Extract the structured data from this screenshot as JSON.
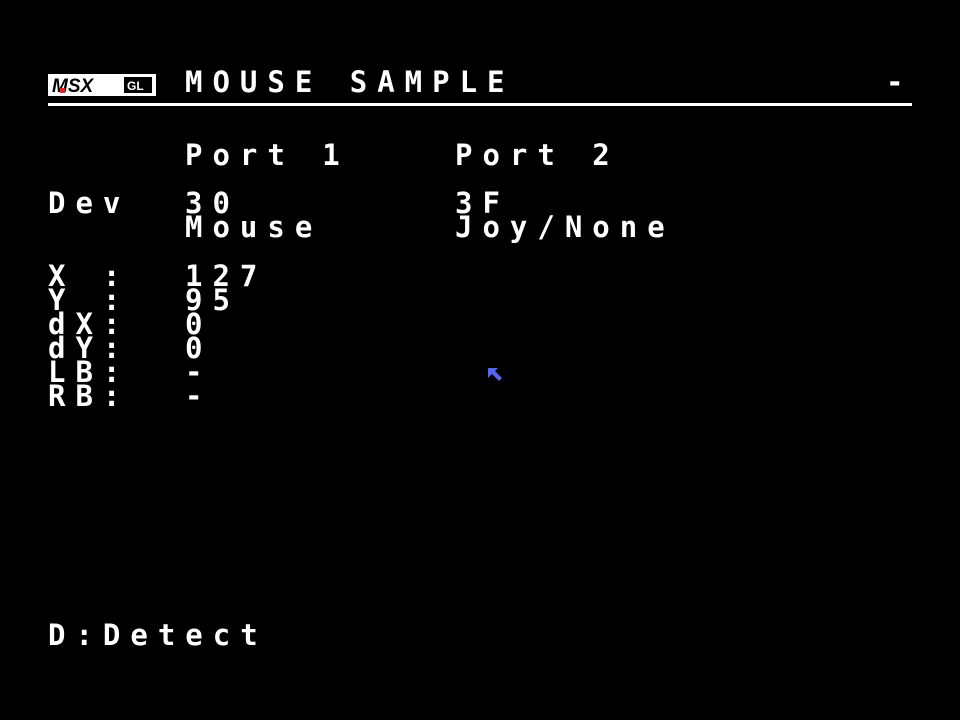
{
  "header": {
    "logo_text": "MSX GL",
    "title": "MOUSE SAMPLE",
    "indicator": "-"
  },
  "ports": {
    "port1_label": "Port 1",
    "port2_label": "Port 2"
  },
  "device": {
    "label": "Dev",
    "port1_id": "30",
    "port1_name": "Mouse",
    "port2_id": "3F",
    "port2_name": "Joy/None"
  },
  "readouts": [
    {
      "label": "X :",
      "value": "127"
    },
    {
      "label": "Y :",
      "value": "95"
    },
    {
      "label": "dX:",
      "value": "0"
    },
    {
      "label": "dY:",
      "value": "0"
    },
    {
      "label": "LB:",
      "value": "-"
    },
    {
      "label": "RB:",
      "value": "-"
    }
  ],
  "footer": {
    "hint": "D:Detect"
  },
  "colors": {
    "background": "#000000",
    "text": "#ffffff",
    "cursor": "#5566ee",
    "logo_accent": "#ee2222"
  },
  "icons": {
    "pointer": "arrow-cursor-icon"
  }
}
